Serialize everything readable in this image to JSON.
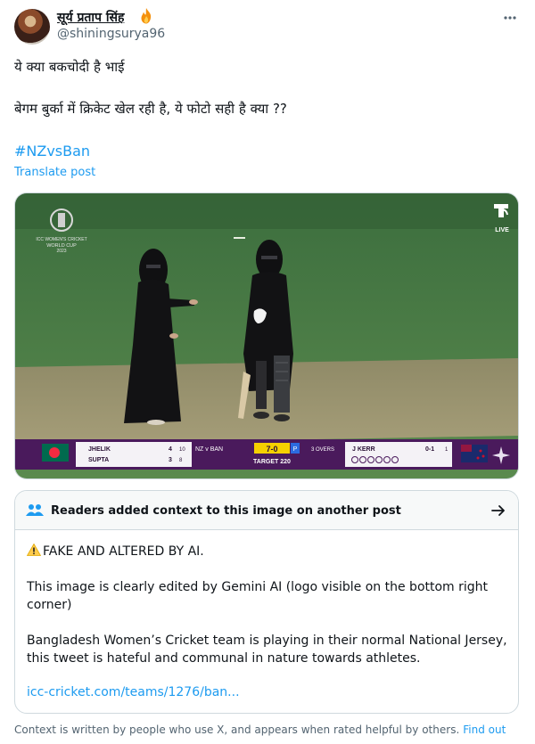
{
  "author": {
    "display_name": "सूर्य प्रताप सिंह",
    "handle": "@shiningsurya96",
    "badge_icon": "fire-icon"
  },
  "tweet": {
    "line1": "ये क्या बकचोदी है भाई",
    "line2": "बेगम बुर्का में क्रिकेट खेल रही है, ये फोटो सही है क्या ??",
    "hashtag": "#NZvsBan",
    "translate_label": "Translate post"
  },
  "media": {
    "broadcaster": "LIVE",
    "event_logo_text": "ICC WOMEN'S CRICKET WORLD CUP 2023",
    "scorebar": {
      "batter1_name": "JHELIK",
      "batter1_runs": "4",
      "batter1_balls": "10",
      "batter2_name": "SUPTA",
      "batter2_runs": "3",
      "batter2_balls": "8",
      "match": "NZ v BAN",
      "score": "7-0",
      "powerplay": "P",
      "overs": "3 OVERS",
      "target": "TARGET 220",
      "bowler_name": "J KERR",
      "bowler_figures": "0-1",
      "bowler_overs": "1"
    }
  },
  "community_note": {
    "title": "Readers added context to this image on another post",
    "warning": "FAKE AND ALTERED BY AI.",
    "paragraph1": "This image is clearly edited by Gemini AI (logo visible on the bottom right corner)",
    "paragraph2": "Bangladesh Women’s Cricket team is playing in their normal National Jersey, this tweet is hateful and communal in nature towards athletes.",
    "link": "icc-cricket.com/teams/1276/ban..."
  },
  "footer": {
    "text": "Context is written by people who use X, and appears when rated helpful by others.",
    "link_label": "Find out"
  },
  "colors": {
    "link_blue": "#1d9bf0",
    "text_primary": "#0f1419",
    "text_secondary": "#536471",
    "scorebar_purple": "#4a1a5c"
  }
}
